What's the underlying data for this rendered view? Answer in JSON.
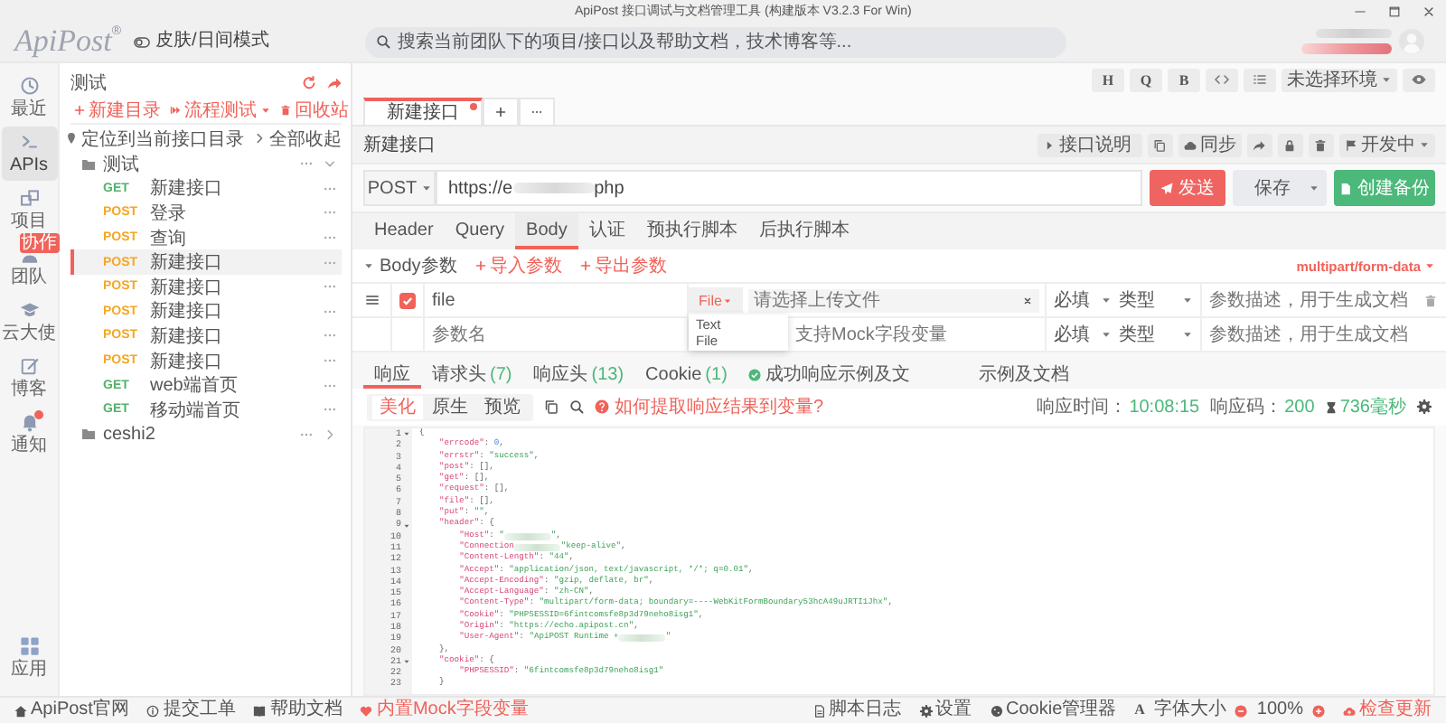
{
  "window": {
    "title": "ApiPost 接口调试与文档管理工具 (构建版本 V3.2.3 For Win)"
  },
  "top_bar": {
    "logo": "ApiPost",
    "logo_mark": "®",
    "theme_toggle": "皮肤/日间模式",
    "search": {
      "placeholder": "搜索当前团队下的项目/接口以及帮助文档，技术博客等..."
    }
  },
  "nav": [
    {
      "label": "最近",
      "selected": false,
      "dot": false
    },
    {
      "label": "APIs",
      "selected": true,
      "dot": false
    },
    {
      "label": "项目",
      "selected": false,
      "dot": false
    },
    {
      "label": "团队",
      "selected": false,
      "dot": false,
      "badge": "协作"
    },
    {
      "label": "云大使",
      "selected": false,
      "dot": false
    },
    {
      "label": "博客",
      "selected": false,
      "dot": false
    },
    {
      "label": "通知",
      "selected": false,
      "dot": true
    }
  ],
  "nav_bottom": {
    "label": "应用"
  },
  "tree_panel": {
    "title": "测试",
    "actions": [
      {
        "label": "新建目录",
        "menu": false
      },
      {
        "label": "流程测试",
        "menu": true
      },
      {
        "label": "回收站",
        "menu": false
      }
    ],
    "locate": "定位到当前接口目录",
    "collapse": "全部收起",
    "items": [
      {
        "kind": "folder",
        "name": "测试",
        "expanded": true,
        "children": [
          {
            "kind": "api",
            "method": "GET",
            "color": "#52b26b",
            "name": "新建接口",
            "selected": false
          },
          {
            "kind": "api",
            "method": "POST",
            "color": "#f5a623",
            "name": "登录",
            "selected": false
          },
          {
            "kind": "api",
            "method": "POST",
            "color": "#f5a623",
            "name": "查询",
            "selected": false
          },
          {
            "kind": "api",
            "method": "POST",
            "color": "#f5a623",
            "name": "新建接口",
            "selected": true
          },
          {
            "kind": "api",
            "method": "POST",
            "color": "#f5a623",
            "name": "新建接口",
            "selected": false
          },
          {
            "kind": "api",
            "method": "POST",
            "color": "#f5a623",
            "name": "新建接口",
            "selected": false
          },
          {
            "kind": "api",
            "method": "POST",
            "color": "#f5a623",
            "name": "新建接口",
            "selected": false
          },
          {
            "kind": "api",
            "method": "POST",
            "color": "#f5a623",
            "name": "新建接口",
            "selected": false
          },
          {
            "kind": "api",
            "method": "GET",
            "color": "#52b26b",
            "name": "web端首页",
            "selected": false
          },
          {
            "kind": "api",
            "method": "GET",
            "color": "#52b26b",
            "name": "移动端首页",
            "selected": false
          }
        ]
      },
      {
        "kind": "folder",
        "name": "ceshi2",
        "expanded": false
      }
    ]
  },
  "env_toolbar": {
    "letter_buttons": [
      "H",
      "Q",
      "B"
    ],
    "environment": "未选择环境"
  },
  "tabs": [
    {
      "label": "新建接口",
      "selected": true,
      "unsaved": true
    }
  ],
  "api_bar": {
    "title": "新建接口",
    "doc": "接口说明",
    "sync": "同步",
    "status": "开发中"
  },
  "request": {
    "method": "POST",
    "url_start": "https://e",
    "url_end": "php",
    "send": "发送",
    "save": "保存",
    "backup": "创建备份"
  },
  "request_tabs": [
    {
      "label": "Header",
      "selected": false
    },
    {
      "label": "Query",
      "selected": false
    },
    {
      "label": "Body",
      "selected": true
    },
    {
      "label": "认证",
      "selected": false
    },
    {
      "label": "预执行脚本",
      "selected": false
    },
    {
      "label": "后执行脚本",
      "selected": false
    }
  ],
  "body": {
    "label": "Body参数",
    "expanded": true,
    "import": "导入参数",
    "export": "导出参数",
    "content_type": "multipart/form-data",
    "params": [
      {
        "kind": "param",
        "enabled": true,
        "name": "file",
        "type": "File",
        "value_placeholder": "请选择上传文件",
        "required": "必填",
        "data_type": "类型",
        "description_placeholder": "参数描述，用于生成文档"
      },
      {
        "kind": "blank",
        "name_placeholder": "参数名",
        "value_placeholder": "支持Mock字段变量",
        "required": "必填",
        "data_type": "类型",
        "description_placeholder": "参数描述，用于生成文档"
      }
    ],
    "type_options": [
      {
        "label": "Text"
      },
      {
        "label": "File"
      }
    ]
  },
  "response_tabs": [
    {
      "label": "响应",
      "selected": true
    },
    {
      "label": "请求头",
      "count": "(7)",
      "selected": false
    },
    {
      "label": "响应头",
      "count": "(13)",
      "selected": false
    },
    {
      "label": "Cookie",
      "count": "(1)",
      "selected": false
    },
    {
      "label": "成功响应示例及文",
      "selected": false,
      "check": true
    },
    {
      "label": "示例及文档",
      "selected": false
    }
  ],
  "response_toolbar": {
    "modes": [
      {
        "label": "美化",
        "selected": true
      },
      {
        "label": "原生",
        "selected": false
      },
      {
        "label": "预览",
        "selected": false
      }
    ],
    "help": "如何提取响应结果到变量?",
    "time_label": "响应时间：",
    "time": "10:08:15",
    "code_label": "响应码：",
    "code": "200",
    "duration": "736毫秒"
  },
  "code_lines": [
    {
      "number": "1",
      "fold": true,
      "parts": [
        {
          "kind": "punct",
          "text": "{"
        }
      ],
      "children": [
        {
          "number": "2",
          "fold": false,
          "parts": [
            {
              "kind": "key",
              "text": "\"errcode\""
            },
            {
              "kind": "punct",
              "text": ": "
            },
            {
              "kind": "number",
              "text": "0"
            },
            {
              "kind": "punct",
              "text": ","
            }
          ]
        },
        {
          "number": "3",
          "fold": false,
          "parts": [
            {
              "kind": "key",
              "text": "\"errstr\""
            },
            {
              "kind": "punct",
              "text": ": "
            },
            {
              "kind": "string",
              "text": "\"success\""
            },
            {
              "kind": "punct",
              "text": ","
            }
          ]
        },
        {
          "number": "4",
          "fold": false,
          "parts": [
            {
              "kind": "key",
              "text": "\"post\""
            },
            {
              "kind": "punct",
              "text": ": [],"
            }
          ]
        },
        {
          "number": "5",
          "fold": false,
          "parts": [
            {
              "kind": "key",
              "text": "\"get\""
            },
            {
              "kind": "punct",
              "text": ": [],"
            }
          ]
        },
        {
          "number": "6",
          "fold": false,
          "parts": [
            {
              "kind": "key",
              "text": "\"request\""
            },
            {
              "kind": "punct",
              "text": ": [],"
            }
          ]
        },
        {
          "number": "7",
          "fold": false,
          "parts": [
            {
              "kind": "key",
              "text": "\"file\""
            },
            {
              "kind": "punct",
              "text": ": [],"
            }
          ]
        },
        {
          "number": "8",
          "fold": false,
          "parts": [
            {
              "kind": "key",
              "text": "\"put\""
            },
            {
              "kind": "punct",
              "text": ": "
            },
            {
              "kind": "string",
              "text": "\"\""
            },
            {
              "kind": "punct",
              "text": ","
            }
          ]
        },
        {
          "number": "9",
          "fold": true,
          "parts": [
            {
              "kind": "key",
              "text": "\"header\""
            },
            {
              "kind": "punct",
              "text": ": {"
            }
          ],
          "children": [
            {
              "number": "10",
              "fold": false,
              "parts": [
                {
                  "kind": "key",
                  "text": "\"Host\""
                },
                {
                  "kind": "punct",
                  "text": ": "
                },
                {
                  "kind": "string",
                  "text": "\""
                },
                {
                  "kind": "blur"
                },
                {
                  "kind": "string",
                  "text": "\""
                },
                {
                  "kind": "punct",
                  "text": ","
                }
              ]
            },
            {
              "number": "11",
              "fold": false,
              "parts": [
                {
                  "kind": "key",
                  "text": "\"Connection"
                },
                {
                  "kind": "blur"
                },
                {
                  "kind": "string",
                  "text": "\"keep-alive\""
                },
                {
                  "kind": "punct",
                  "text": ","
                }
              ]
            },
            {
              "number": "12",
              "fold": false,
              "parts": [
                {
                  "kind": "key",
                  "text": "\"Content-Length\""
                },
                {
                  "kind": "punct",
                  "text": ": "
                },
                {
                  "kind": "string",
                  "text": "\"44\""
                },
                {
                  "kind": "punct",
                  "text": ","
                }
              ]
            },
            {
              "number": "13",
              "fold": false,
              "parts": [
                {
                  "kind": "key",
                  "text": "\"Accept\""
                },
                {
                  "kind": "punct",
                  "text": ": "
                },
                {
                  "kind": "string",
                  "text": "\"application/json, text/javascript, */*; q=0.01\""
                },
                {
                  "kind": "punct",
                  "text": ","
                }
              ]
            },
            {
              "number": "14",
              "fold": false,
              "parts": [
                {
                  "kind": "key",
                  "text": "\"Accept-Encoding\""
                },
                {
                  "kind": "punct",
                  "text": ": "
                },
                {
                  "kind": "string",
                  "text": "\"gzip, deflate, br\""
                },
                {
                  "kind": "punct",
                  "text": ","
                }
              ]
            },
            {
              "number": "15",
              "fold": false,
              "parts": [
                {
                  "kind": "key",
                  "text": "\"Accept-Language\""
                },
                {
                  "kind": "punct",
                  "text": ": "
                },
                {
                  "kind": "string",
                  "text": "\"zh-CN\""
                },
                {
                  "kind": "punct",
                  "text": ","
                }
              ]
            },
            {
              "number": "16",
              "fold": false,
              "parts": [
                {
                  "kind": "key",
                  "text": "\"Content-Type\""
                },
                {
                  "kind": "punct",
                  "text": ": "
                },
                {
                  "kind": "string",
                  "text": "\"multipart/form-data; boundary=----WebKitFormBoundary53hcA49uJRTI1Jhx\""
                },
                {
                  "kind": "punct",
                  "text": ","
                }
              ]
            },
            {
              "number": "17",
              "fold": false,
              "parts": [
                {
                  "kind": "key",
                  "text": "\"Cookie\""
                },
                {
                  "kind": "punct",
                  "text": ": "
                },
                {
                  "kind": "string",
                  "text": "\"PHPSESSID=6fintcomsfe8p3d79neho8isg1\""
                },
                {
                  "kind": "punct",
                  "text": ","
                }
              ]
            },
            {
              "number": "18",
              "fold": false,
              "parts": [
                {
                  "kind": "key",
                  "text": "\"Origin\""
                },
                {
                  "kind": "punct",
                  "text": ": "
                },
                {
                  "kind": "string",
                  "text": "\"https://echo.apipost.cn\""
                },
                {
                  "kind": "punct",
                  "text": ","
                }
              ]
            },
            {
              "number": "19",
              "fold": false,
              "parts": [
                {
                  "kind": "key",
                  "text": "\"User-Agent\""
                },
                {
                  "kind": "punct",
                  "text": ": "
                },
                {
                  "kind": "string",
                  "text": "\"ApiPOST Runtime +"
                },
                {
                  "kind": "blur"
                },
                {
                  "kind": "string",
                  "text": "\""
                }
              ]
            }
          ]
        },
        {
          "number": "20",
          "fold": false,
          "parts": [
            {
              "kind": "punct",
              "text": "},"
            }
          ]
        },
        {
          "number": "21",
          "fold": true,
          "parts": [
            {
              "kind": "key",
              "text": "\"cookie\""
            },
            {
              "kind": "punct",
              "text": ": {"
            }
          ],
          "children": [
            {
              "number": "22",
              "fold": false,
              "parts": [
                {
                  "kind": "key",
                  "text": "\"PHPSESSID\""
                },
                {
                  "kind": "punct",
                  "text": ": "
                },
                {
                  "kind": "string",
                  "text": "\"6fintcomsfe8p3d79neho8isg1\""
                }
              ]
            }
          ]
        },
        {
          "number": "23",
          "fold": false,
          "parts": [
            {
              "kind": "punct",
              "text": "}"
            }
          ]
        }
      ]
    }
  ],
  "status_bar": {
    "left": [
      {
        "label": "ApiPost官网"
      },
      {
        "label": "提交工单"
      },
      {
        "label": "帮助文档"
      },
      {
        "label": "内置Mock字段变量"
      }
    ],
    "right": [
      {
        "label": "脚本日志"
      },
      {
        "label": "设置"
      },
      {
        "label": "Cookie管理器"
      }
    ],
    "font_size": {
      "glyph": "A",
      "label": "字体大小",
      "value": "100%"
    },
    "update": "检查更新"
  }
}
